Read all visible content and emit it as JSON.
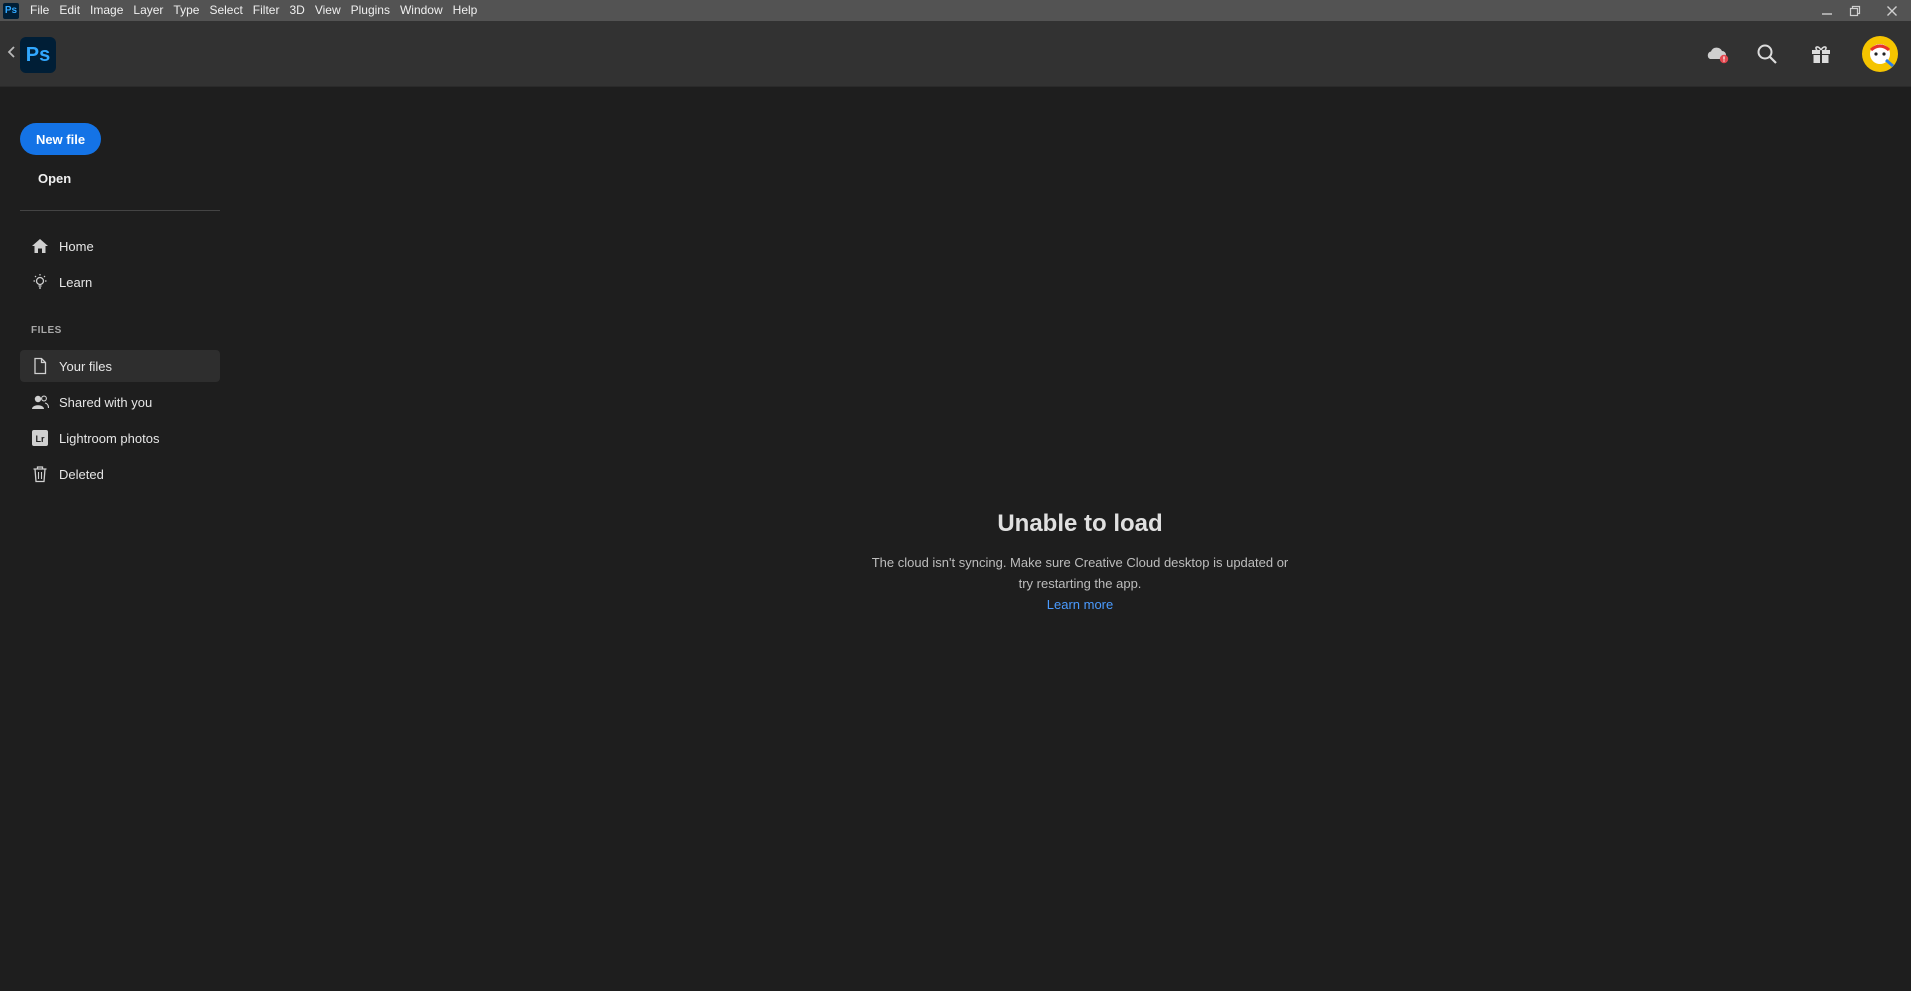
{
  "menubar": {
    "app_icon": "Ps",
    "items": [
      "File",
      "Edit",
      "Image",
      "Layer",
      "Type",
      "Select",
      "Filter",
      "3D",
      "View",
      "Plugins",
      "Window",
      "Help"
    ]
  },
  "header": {
    "logo": "Ps",
    "icons": [
      "cloud-sync-error-icon",
      "search-icon",
      "gift-icon",
      "avatar"
    ]
  },
  "sidebar": {
    "new_file": "New file",
    "open": "Open",
    "nav": [
      {
        "label": "Home",
        "icon": "home-icon"
      },
      {
        "label": "Learn",
        "icon": "lightbulb-icon"
      }
    ],
    "files_section": "FILES",
    "files": [
      {
        "label": "Your files",
        "icon": "file-icon",
        "active": true
      },
      {
        "label": "Shared with you",
        "icon": "shared-users-icon"
      },
      {
        "label": "Lightroom photos",
        "icon": "lightroom-icon"
      },
      {
        "label": "Deleted",
        "icon": "trash-icon"
      }
    ]
  },
  "main": {
    "title": "Unable to load",
    "message": "The cloud isn't syncing. Make sure Creative Cloud desktop is updated or try restarting the app.",
    "link": "Learn more"
  },
  "colors": {
    "accent": "#1473e6",
    "link": "#4a9bff",
    "background": "#1e1e1e",
    "header": "#323232",
    "menubar": "#535353"
  }
}
